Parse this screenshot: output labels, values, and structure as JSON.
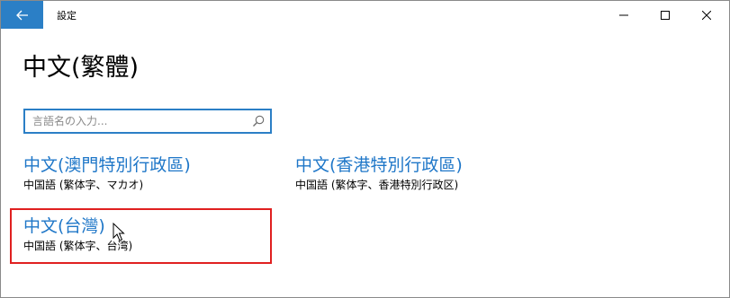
{
  "window": {
    "title": "設定"
  },
  "page": {
    "title": "中文(繁體)"
  },
  "search": {
    "placeholder": "言語名の入力..."
  },
  "languages": [
    {
      "name": "中文(澳門特別行政區)",
      "desc": "中国語 (繁体字、マカオ)"
    },
    {
      "name": "中文(香港特別行政區)",
      "desc": "中国語 (繁体字、香港特別行政区)"
    },
    {
      "name": "中文(台灣)",
      "desc": "中国語 (繁体字、台湾)"
    }
  ],
  "icons": {
    "back": "back-arrow-icon",
    "minimize": "minimize-icon",
    "maximize": "maximize-icon",
    "close": "close-icon",
    "search": "search-icon",
    "cursor": "mouse-pointer-icon"
  },
  "colors": {
    "accent": "#2b7fc6",
    "link": "#1f77c8",
    "highlight": "#e02020"
  }
}
